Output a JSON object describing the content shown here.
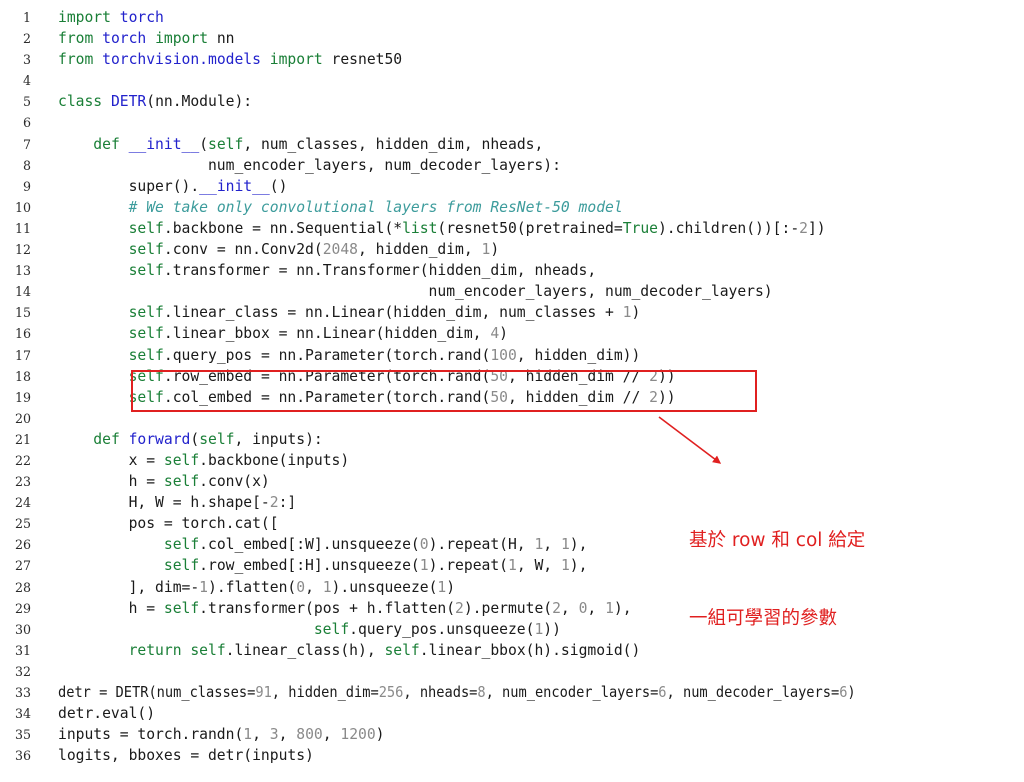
{
  "figure": {
    "type": "code-listing",
    "language": "python",
    "title": "DETR minimal implementation",
    "background_color": "#ffffff",
    "token_colors": {
      "keyword": "#1a7f37",
      "name": "#2222cc",
      "comment": "#3d9c9c",
      "number": "#8a8a8a",
      "plain": "#1a1a1a",
      "linenumber": "#2b2b2b",
      "annotation": "#e02020"
    }
  },
  "code": {
    "line_numbers": [
      "1",
      "2",
      "3",
      "4",
      "5",
      "6",
      "7",
      "8",
      "9",
      "10",
      "11",
      "12",
      "13",
      "14",
      "15",
      "16",
      "17",
      "18",
      "19",
      "20",
      "21",
      "22",
      "23",
      "24",
      "25",
      "26",
      "27",
      "28",
      "29",
      "30",
      "31",
      "32",
      "33",
      "34",
      "35",
      "36"
    ],
    "lines": [
      "import torch",
      "from torch import nn",
      "from torchvision.models import resnet50",
      "",
      "class DETR(nn.Module):",
      "",
      "    def __init__(self, num_classes, hidden_dim, nheads,",
      "                 num_encoder_layers, num_decoder_layers):",
      "        super().__init__()",
      "        # We take only convolutional layers from ResNet-50 model",
      "        self.backbone = nn.Sequential(*list(resnet50(pretrained=True).children())[:-2])",
      "        self.conv = nn.Conv2d(2048, hidden_dim, 1)",
      "        self.transformer = nn.Transformer(hidden_dim, nheads,",
      "                                          num_encoder_layers, num_decoder_layers)",
      "        self.linear_class = nn.Linear(hidden_dim, num_classes + 1)",
      "        self.linear_bbox = nn.Linear(hidden_dim, 4)",
      "        self.query_pos = nn.Parameter(torch.rand(100, hidden_dim))",
      "        self.row_embed = nn.Parameter(torch.rand(50, hidden_dim // 2))",
      "        self.col_embed = nn.Parameter(torch.rand(50, hidden_dim // 2))",
      "",
      "    def forward(self, inputs):",
      "        x = self.backbone(inputs)",
      "        h = self.conv(x)",
      "        H, W = h.shape[-2:]",
      "        pos = torch.cat([",
      "            self.col_embed[:W].unsqueeze(0).repeat(H, 1, 1),",
      "            self.row_embed[:H].unsqueeze(1).repeat(1, W, 1),",
      "        ], dim=-1).flatten(0, 1).unsqueeze(1)",
      "        h = self.transformer(pos + h.flatten(2).permute(2, 0, 1),",
      "                             self.query_pos.unsqueeze(1))",
      "        return self.linear_class(h), self.linear_bbox(h).sigmoid()",
      "",
      "detr = DETR(num_classes=91, hidden_dim=256, nheads=8, num_encoder_layers=6, num_decoder_layers=6)",
      "detr.eval()",
      "inputs = torch.randn(1, 3, 800, 1200)",
      "logits, bboxes = detr(inputs)"
    ],
    "tokens": [
      [
        [
          "import",
          "kw"
        ],
        [
          " ",
          "pl"
        ],
        [
          "torch",
          "nm"
        ]
      ],
      [
        [
          "from",
          "kw"
        ],
        [
          " ",
          "pl"
        ],
        [
          "torch",
          "nm"
        ],
        [
          " ",
          "pl"
        ],
        [
          "import",
          "kw"
        ],
        [
          " nn",
          "pl"
        ]
      ],
      [
        [
          "from",
          "kw"
        ],
        [
          " ",
          "pl"
        ],
        [
          "torchvision.models",
          "nm"
        ],
        [
          " ",
          "pl"
        ],
        [
          "import",
          "kw"
        ],
        [
          " resnet50",
          "pl"
        ]
      ],
      [],
      [
        [
          "class",
          "kw"
        ],
        [
          " ",
          "pl"
        ],
        [
          "DETR",
          "nm"
        ],
        [
          "(nn.Module):",
          "pl"
        ]
      ],
      [],
      [
        [
          "    ",
          "pl"
        ],
        [
          "def",
          "kw"
        ],
        [
          " ",
          "pl"
        ],
        [
          "__init__",
          "nm"
        ],
        [
          "(",
          "pl"
        ],
        [
          "self",
          "kw"
        ],
        [
          ", num_classes, hidden_dim, nheads,",
          "pl"
        ]
      ],
      [
        [
          "                 num_encoder_layers, num_decoder_layers):",
          "pl"
        ]
      ],
      [
        [
          "        super().",
          "pl"
        ],
        [
          "__init__",
          "nm"
        ],
        [
          "()",
          "pl"
        ]
      ],
      [
        [
          "        ",
          "pl"
        ],
        [
          "# We take only convolutional layers from ResNet-50 model",
          "cm"
        ]
      ],
      [
        [
          "        ",
          "pl"
        ],
        [
          "self",
          "kw"
        ],
        [
          ".backbone = nn.Sequential(*",
          "pl"
        ],
        [
          "list",
          "kw"
        ],
        [
          "(resnet50(pretrained=",
          "pl"
        ],
        [
          "True",
          "kw"
        ],
        [
          ").children())[:-",
          "pl"
        ],
        [
          "2",
          "num"
        ],
        [
          "])",
          "pl"
        ]
      ],
      [
        [
          "        ",
          "pl"
        ],
        [
          "self",
          "kw"
        ],
        [
          ".conv = nn.Conv2d(",
          "pl"
        ],
        [
          "2048",
          "num"
        ],
        [
          ", hidden_dim, ",
          "pl"
        ],
        [
          "1",
          "num"
        ],
        [
          ")",
          "pl"
        ]
      ],
      [
        [
          "        ",
          "pl"
        ],
        [
          "self",
          "kw"
        ],
        [
          ".transformer = nn.Transformer(hidden_dim, nheads,",
          "pl"
        ]
      ],
      [
        [
          "                                          num_encoder_layers, num_decoder_layers)",
          "pl"
        ]
      ],
      [
        [
          "        ",
          "pl"
        ],
        [
          "self",
          "kw"
        ],
        [
          ".linear_class = nn.Linear(hidden_dim, num_classes + ",
          "pl"
        ],
        [
          "1",
          "num"
        ],
        [
          ")",
          "pl"
        ]
      ],
      [
        [
          "        ",
          "pl"
        ],
        [
          "self",
          "kw"
        ],
        [
          ".linear_bbox = nn.Linear(hidden_dim, ",
          "pl"
        ],
        [
          "4",
          "num"
        ],
        [
          ")",
          "pl"
        ]
      ],
      [
        [
          "        ",
          "pl"
        ],
        [
          "self",
          "kw"
        ],
        [
          ".query_pos = nn.Parameter(torch.rand(",
          "pl"
        ],
        [
          "100",
          "num"
        ],
        [
          ", hidden_dim))",
          "pl"
        ]
      ],
      [
        [
          "        ",
          "pl"
        ],
        [
          "self",
          "kw"
        ],
        [
          ".row_embed = nn.Parameter(torch.rand(",
          "pl"
        ],
        [
          "50",
          "num"
        ],
        [
          ", hidden_dim // ",
          "pl"
        ],
        [
          "2",
          "num"
        ],
        [
          "))",
          "pl"
        ]
      ],
      [
        [
          "        ",
          "pl"
        ],
        [
          "self",
          "kw"
        ],
        [
          ".col_embed = nn.Parameter(torch.rand(",
          "pl"
        ],
        [
          "50",
          "num"
        ],
        [
          ", hidden_dim // ",
          "pl"
        ],
        [
          "2",
          "num"
        ],
        [
          "))",
          "pl"
        ]
      ],
      [],
      [
        [
          "    ",
          "pl"
        ],
        [
          "def",
          "kw"
        ],
        [
          " ",
          "pl"
        ],
        [
          "forward",
          "nm"
        ],
        [
          "(",
          "pl"
        ],
        [
          "self",
          "kw"
        ],
        [
          ", inputs):",
          "pl"
        ]
      ],
      [
        [
          "        x = ",
          "pl"
        ],
        [
          "self",
          "kw"
        ],
        [
          ".backbone(inputs)",
          "pl"
        ]
      ],
      [
        [
          "        h = ",
          "pl"
        ],
        [
          "self",
          "kw"
        ],
        [
          ".conv(x)",
          "pl"
        ]
      ],
      [
        [
          "        H, W = h.shape[-",
          "pl"
        ],
        [
          "2",
          "num"
        ],
        [
          ":]",
          "pl"
        ]
      ],
      [
        [
          "        pos = torch.cat([",
          "pl"
        ]
      ],
      [
        [
          "            ",
          "pl"
        ],
        [
          "self",
          "kw"
        ],
        [
          ".col_embed[:W].unsqueeze(",
          "pl"
        ],
        [
          "0",
          "num"
        ],
        [
          ").repeat(H, ",
          "pl"
        ],
        [
          "1",
          "num"
        ],
        [
          ", ",
          "pl"
        ],
        [
          "1",
          "num"
        ],
        [
          "),",
          "pl"
        ]
      ],
      [
        [
          "            ",
          "pl"
        ],
        [
          "self",
          "kw"
        ],
        [
          ".row_embed[:H].unsqueeze(",
          "pl"
        ],
        [
          "1",
          "num"
        ],
        [
          ").repeat(",
          "pl"
        ],
        [
          "1",
          "num"
        ],
        [
          ", W, ",
          "pl"
        ],
        [
          "1",
          "num"
        ],
        [
          "),",
          "pl"
        ]
      ],
      [
        [
          "        ], dim=-",
          "pl"
        ],
        [
          "1",
          "num"
        ],
        [
          ").flatten(",
          "pl"
        ],
        [
          "0",
          "num"
        ],
        [
          ", ",
          "pl"
        ],
        [
          "1",
          "num"
        ],
        [
          ").unsqueeze(",
          "pl"
        ],
        [
          "1",
          "num"
        ],
        [
          ")",
          "pl"
        ]
      ],
      [
        [
          "        h = ",
          "pl"
        ],
        [
          "self",
          "kw"
        ],
        [
          ".transformer(pos + h.flatten(",
          "pl"
        ],
        [
          "2",
          "num"
        ],
        [
          ").permute(",
          "pl"
        ],
        [
          "2",
          "num"
        ],
        [
          ", ",
          "pl"
        ],
        [
          "0",
          "num"
        ],
        [
          ", ",
          "pl"
        ],
        [
          "1",
          "num"
        ],
        [
          "),",
          "pl"
        ]
      ],
      [
        [
          "                             ",
          "pl"
        ],
        [
          "self",
          "kw"
        ],
        [
          ".query_pos.unsqueeze(",
          "pl"
        ],
        [
          "1",
          "num"
        ],
        [
          "))",
          "pl"
        ]
      ],
      [
        [
          "        ",
          "pl"
        ],
        [
          "return",
          "kw"
        ],
        [
          " ",
          "pl"
        ],
        [
          "self",
          "kw"
        ],
        [
          ".linear_class(h), ",
          "pl"
        ],
        [
          "self",
          "kw"
        ],
        [
          ".linear_bbox(h).sigmoid()",
          "pl"
        ]
      ],
      [],
      [
        [
          "detr = DETR(num_classes=",
          "pl"
        ],
        [
          "91",
          "num"
        ],
        [
          ", hidden_dim=",
          "pl"
        ],
        [
          "256",
          "num"
        ],
        [
          ", nheads=",
          "pl"
        ],
        [
          "8",
          "num"
        ],
        [
          ", num_encoder_layers=",
          "pl"
        ],
        [
          "6",
          "num"
        ],
        [
          ", num_decoder_layers=",
          "pl"
        ],
        [
          "6",
          "num"
        ],
        [
          ")",
          "pl"
        ]
      ],
      [
        [
          "detr.eval()",
          "pl"
        ]
      ],
      [
        [
          "inputs = torch.randn(",
          "pl"
        ],
        [
          "1",
          "num"
        ],
        [
          ", ",
          "pl"
        ],
        [
          "3",
          "num"
        ],
        [
          ", ",
          "pl"
        ],
        [
          "800",
          "num"
        ],
        [
          ", ",
          "pl"
        ],
        [
          "1200",
          "num"
        ],
        [
          ")",
          "pl"
        ]
      ],
      [
        [
          "logits, bboxes = detr(inputs)",
          "pl"
        ]
      ]
    ]
  },
  "annotation": {
    "highlight_box": {
      "label": "row-col-embed-highlight",
      "covers_lines": [
        "18",
        "19"
      ],
      "color": "#e02020"
    },
    "arrow": {
      "label": "callout-arrow",
      "color": "#e02020"
    },
    "text_lines": [
      "基於 row 和 col 給定",
      "一組可學習的參數"
    ],
    "color": "#e02020"
  }
}
